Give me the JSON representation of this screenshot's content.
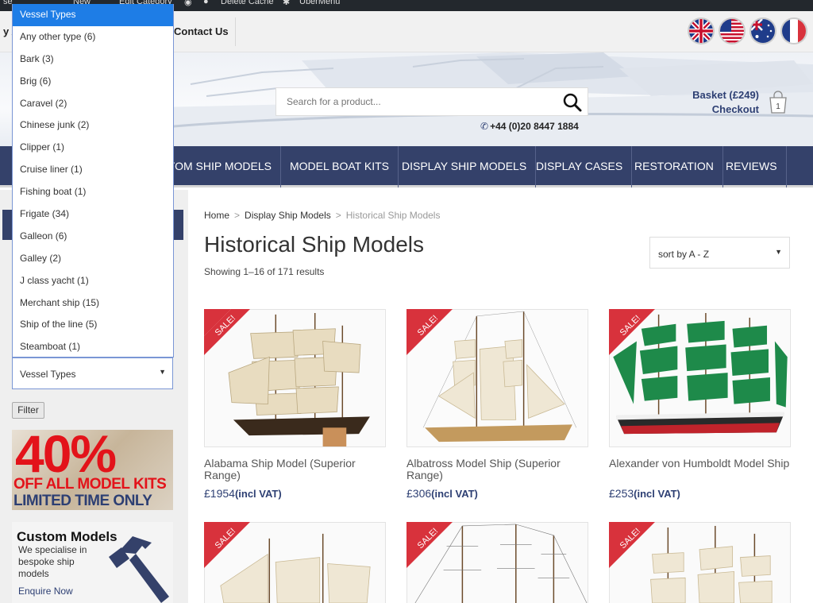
{
  "adminbar": {
    "items": [
      "New",
      "Edit Category",
      "Delete Cache",
      "UberMenu"
    ]
  },
  "topbar": {
    "links": [
      "Contact Us"
    ]
  },
  "flags": [
    "uk-flag-icon",
    "us-flag-icon",
    "australia-flag-icon",
    "france-flag-icon"
  ],
  "header": {
    "search_placeholder": "Search for a product...",
    "phone": "+44 (0)20 8447 1884",
    "basket": "Basket (£249)",
    "checkout": "Checkout",
    "basket_count": "1"
  },
  "nav": {
    "items": [
      "CUSTOM SHIP MODELS",
      "MODEL BOAT KITS",
      "DISPLAY SHIP MODELS",
      "DISPLAY CASES",
      "RESTORATION",
      "REVIEWS"
    ]
  },
  "sidebar": {
    "dropdown_options": [
      "Vessel Types",
      "Any other type (6)",
      "Bark (3)",
      "Brig (6)",
      "Caravel (2)",
      "Chinese junk (2)",
      "Clipper (1)",
      "Cruise liner (1)",
      "Fishing boat (1)",
      "Frigate (34)",
      "Galleon (6)",
      "Galley (2)",
      "J class yacht (1)",
      "Merchant ship (15)",
      "Ship of the line (5)",
      "Steamboat (1)"
    ],
    "select_value": "Vessel Types",
    "filter_label": "Filter",
    "promo1": {
      "pct": "40%",
      "line1": "OFF ALL MODEL KITS",
      "line2": "LIMITED TIME ONLY"
    },
    "promo2": {
      "title": "Custom Models",
      "desc": "We specialise in bespoke ship models",
      "cta": "Enquire Now"
    }
  },
  "main": {
    "breadcrumb": [
      "Home",
      "Display Ship Models",
      "Historical Ship Models"
    ],
    "title": "Historical Ship Models",
    "showing": "Showing 1–16 of 171 results",
    "sort": "sort by A - Z",
    "sale_badge": "SALE!",
    "products": [
      {
        "name": "Alabama Ship Model (Superior Range)",
        "price": "£1954",
        "vat": "(incl VAT)"
      },
      {
        "name": "Albatross Model Ship (Superior Range)",
        "price": "£306",
        "vat": "(incl VAT)"
      },
      {
        "name": "Alexander von Humboldt Model Ship",
        "price": "£253",
        "vat": "(incl VAT)"
      },
      {
        "name": "",
        "price": "",
        "vat": ""
      },
      {
        "name": "",
        "price": "",
        "vat": ""
      },
      {
        "name": "",
        "price": "",
        "vat": ""
      }
    ]
  },
  "colors": {
    "navy": "#34416a",
    "sale": "#d8323c",
    "selected": "#1e7de6",
    "promo_red": "#e3131a"
  }
}
